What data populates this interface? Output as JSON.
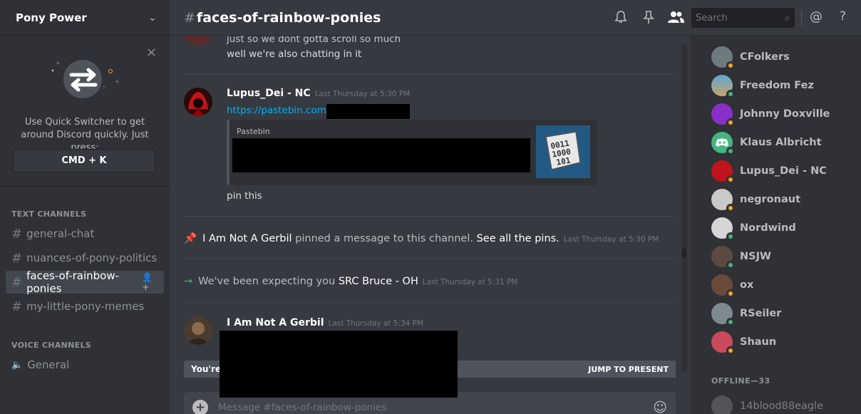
{
  "server": {
    "name": "Pony Power"
  },
  "quick_switcher": {
    "text": "Use Quick Switcher to get around Discord quickly. Just press:",
    "shortcut": "CMD + K"
  },
  "categories": {
    "text": "TEXT CHANNELS",
    "voice": "VOICE CHANNELS"
  },
  "text_channels": [
    {
      "name": "general-chat"
    },
    {
      "name": "nuances-of-pony-politics"
    },
    {
      "name": "faces-of-rainbow-ponies"
    },
    {
      "name": "my-little-pony-memes"
    }
  ],
  "voice_channels": [
    {
      "name": "General"
    }
  ],
  "header": {
    "channel": "faces-of-rainbow-ponies",
    "search_placeholder": "Search"
  },
  "messages": {
    "top_line1": "just so we dont gotta scroll so much",
    "top_line2": "well we're also chatting in it",
    "m1_user": "Lupus_Dei - NC",
    "m1_time": "Last Thursday at 5:30 PM",
    "m1_link": "https://pastebin.com/",
    "m1_embed_provider": "Pastebin",
    "m1_after": "pin this",
    "pin_user": "I Am Not A Gerbil",
    "pin_mid": " pinned a message to this channel. ",
    "pin_link": "See all the pins.",
    "pin_time": "Last Thursday at 5:30 PM",
    "join_pre": "We've been expecting you ",
    "join_user": "SRC Bruce - OH",
    "join_time": "Last Thursday at 5:31 PM",
    "m2_user": "I Am Not A Gerbil",
    "m2_time": "Last Thursday at 5:34 PM",
    "newbar_left": "You're",
    "newbar_jump": "JUMP TO PRESENT",
    "compose_placeholder": "Message #faces-of-rainbow-ponies"
  },
  "members": [
    {
      "name": "CFolkers",
      "status": "idle"
    },
    {
      "name": "Freedom Fez",
      "status": "online"
    },
    {
      "name": "Johnny Doxville",
      "status": "idle"
    },
    {
      "name": "Klaus Albricht",
      "status": "online"
    },
    {
      "name": "Lupus_Dei - NC",
      "status": "idle"
    },
    {
      "name": "negronaut",
      "status": "idle"
    },
    {
      "name": "Nordwind",
      "status": "online"
    },
    {
      "name": "NSJW",
      "status": "online"
    },
    {
      "name": "ox",
      "status": "idle"
    },
    {
      "name": "RSeiler",
      "status": "online"
    },
    {
      "name": "Shaun",
      "status": "idle"
    }
  ],
  "offline": {
    "header": "OFFLINE—33",
    "first": "14blood88eagle"
  },
  "colors": {
    "online": "#43b581",
    "idle": "#faa61a",
    "link": "#00b0f4",
    "bg": "#36393f",
    "sidebar": "#2f3136"
  }
}
